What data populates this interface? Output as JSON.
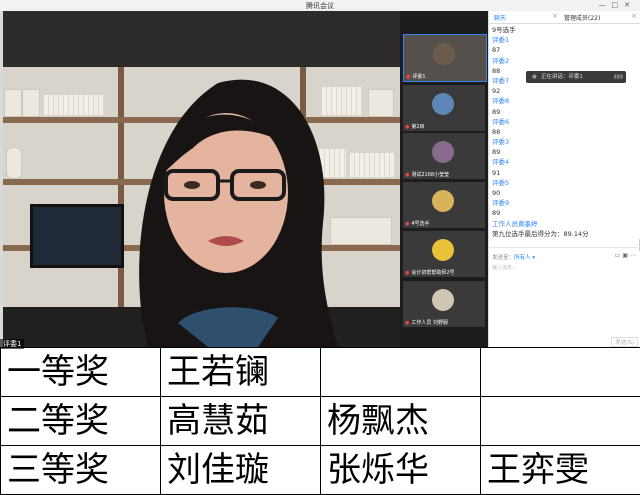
{
  "window": {
    "title": "腾讯会议"
  },
  "main_video": {
    "label": "评委1"
  },
  "participants": [
    {
      "label": "评委1",
      "avatar_color": "#6b5c4e"
    },
    {
      "label": "第2目",
      "avatar_color": "#5e87b8"
    },
    {
      "label": "测试2168小莹莹",
      "avatar_color": "#8a6a8f"
    },
    {
      "label": "4号选手",
      "avatar_color": "#d9b35a"
    },
    {
      "label": "会计初帮帮助师2号",
      "avatar_color": "#e8c23a"
    },
    {
      "label": "工作人员 刘野服",
      "avatar_color": "#cfc6b4"
    }
  ],
  "chat": {
    "tab_chat": "聊天",
    "tab_members": "管理成员(22)",
    "messages": [
      {
        "text": "9号选手",
        "type": "text"
      },
      {
        "text": "评委1",
        "type": "name"
      },
      {
        "text": "87",
        "type": "text"
      },
      {
        "text": "评委2",
        "type": "name"
      },
      {
        "text": "88",
        "type": "text"
      },
      {
        "text": "评委7",
        "type": "name"
      },
      {
        "text": "92",
        "type": "text"
      },
      {
        "text": "评委8",
        "type": "name"
      },
      {
        "text": "89",
        "type": "text"
      },
      {
        "text": "评委6",
        "type": "name"
      },
      {
        "text": "88",
        "type": "text"
      },
      {
        "text": "评委3",
        "type": "name"
      },
      {
        "text": "89",
        "type": "text"
      },
      {
        "text": "评委4",
        "type": "name"
      },
      {
        "text": "91",
        "type": "text"
      },
      {
        "text": "评委5",
        "type": "name"
      },
      {
        "text": "90",
        "type": "text"
      },
      {
        "text": "评委9",
        "type": "name"
      },
      {
        "text": "89",
        "type": "text"
      },
      {
        "text": "工作人员黄墨婷",
        "type": "name"
      },
      {
        "text": "第九位选手最后得分为：89.14分",
        "type": "text"
      }
    ],
    "speaking_toast": "正在讲话：评委1",
    "send_to_label": "发送至：",
    "send_to_value": "所有人",
    "input_placeholder": "输入消息...",
    "send_button": "发送(S)"
  },
  "awards": [
    {
      "level": "一等奖",
      "names": [
        "王若镧",
        "",
        ""
      ]
    },
    {
      "level": "二等奖",
      "names": [
        "高慧茹",
        "杨飘杰",
        ""
      ]
    },
    {
      "level": "三等奖",
      "names": [
        "刘佳璇",
        "张烁华",
        "王弈雯"
      ]
    }
  ],
  "colors": {
    "accent": "#2f86f6",
    "mic_muted": "#e64545"
  }
}
